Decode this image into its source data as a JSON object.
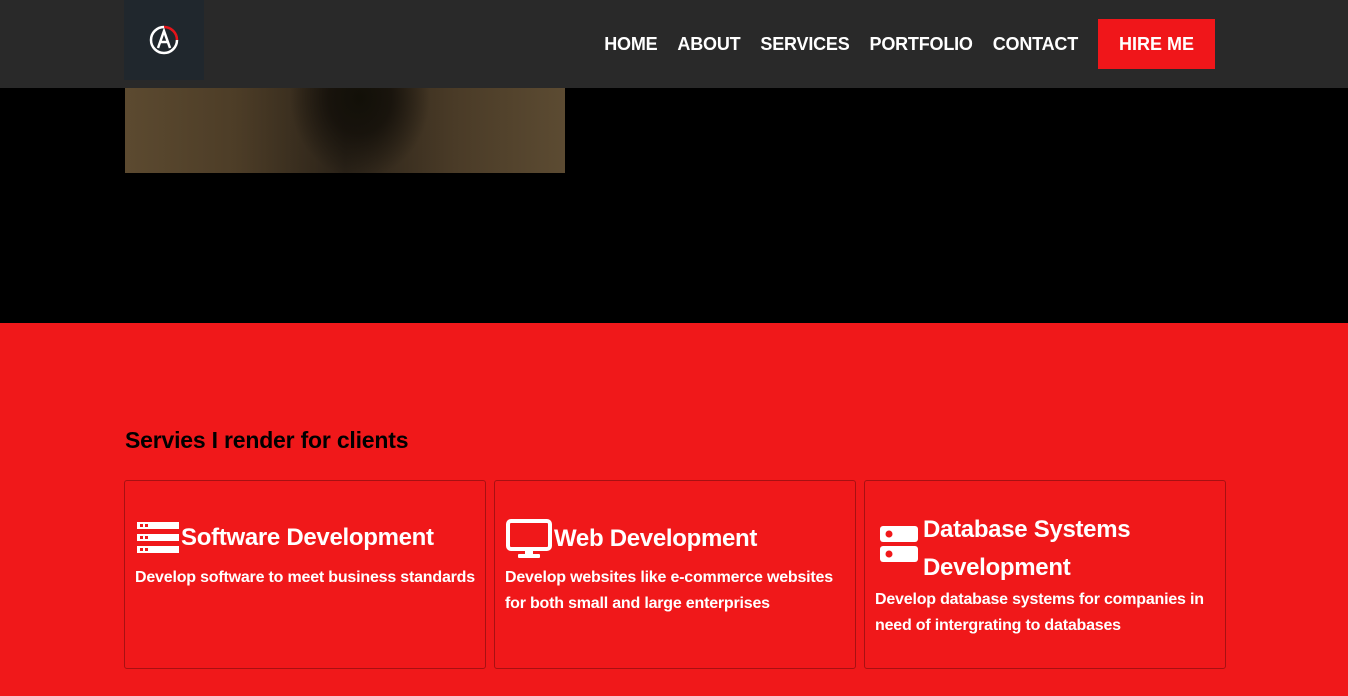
{
  "nav": {
    "logo_icon": "logo-a-icon",
    "links": [
      "HOME",
      "ABOUT",
      "SERVICES",
      "PORTFOLIO",
      "CONTACT"
    ],
    "cta_label": "HIRE ME"
  },
  "colors": {
    "nav_bg": "#292929",
    "accent": "#f0181a",
    "hero_bg": "#000000"
  },
  "services": {
    "title": "Servies I render for clients",
    "cards": [
      {
        "icon": "server-list-icon",
        "title": "Software Development",
        "desc": "Develop software to meet business standards"
      },
      {
        "icon": "monitor-icon",
        "title": "Web Development",
        "desc": "Develop websites like e-commerce websites for both small and large enterprises"
      },
      {
        "icon": "database-icon",
        "title": "Database Systems Development",
        "desc": "Develop database systems for companies in need of intergrating to databases"
      }
    ]
  }
}
